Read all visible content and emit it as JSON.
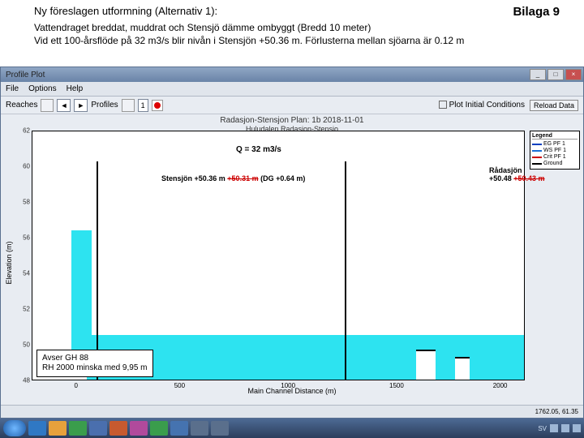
{
  "header": {
    "title_left": "Ny föreslagen utformning (Alternativ 1):",
    "title_right": "Bilaga 9",
    "desc_line1": "Vattendraget breddat, muddrat och Stensjö dämme ombyggt (Bredd 10 meter)",
    "desc_line2": "Vid ett 100-årsflöde på 32 m3/s blir nivån i Stensjön +50.36 m. Förlusterna mellan sjöarna är 0.12 m"
  },
  "window": {
    "title": "Profile Plot"
  },
  "menubar": {
    "file": "File",
    "options": "Options",
    "help": "Help"
  },
  "toolbar": {
    "reaches_label": "Reaches",
    "profiles_label": "Profiles",
    "profiles_value": "1",
    "plot_cond_label": "Plot Initial Conditions",
    "reload_label": "Reload Data"
  },
  "plot": {
    "title": "Radasjon-Stensjon    Plan: 1b  2018-11-01",
    "subtitle": "Huludalen Radasjon-Stensjo",
    "ylabel": "Elevation (m)",
    "xlabel": "Main Channel Distance (m)",
    "yticks": [
      "48",
      "50",
      "52",
      "54",
      "56",
      "58",
      "60",
      "62"
    ],
    "xticks": [
      "0",
      "500",
      "1000",
      "1500",
      "2000"
    ]
  },
  "legend": {
    "title": "Legend",
    "items": [
      "EG PF 1",
      "WS PF 1",
      "Crit PF 1",
      "Ground"
    ]
  },
  "annotations": {
    "q": "Q = 32 m3/s",
    "stensjon": "Stensjön +50.36 m ",
    "stensjon_strike": "+50.31 m",
    "stensjon_tail": " (DG +0.64 m)",
    "radasjon_name": "Rådasjön",
    "radasjon_val": "+50.48 ",
    "radasjon_strike": "+50.43 m",
    "note_line1": "Avser GH 88",
    "note_line2": "RH 2000 minska med 9,95 m"
  },
  "status": {
    "coords": "1762.05, 61.35"
  },
  "taskbar": {
    "colors": [
      "#2f78c4",
      "#e7a13c",
      "#3a9d4c",
      "#4a6fae",
      "#c75a2f",
      "#b04a9c",
      "#3a9d4c",
      "#4573b0",
      "#5a6f8c",
      "#5a6f8c"
    ],
    "tray_text": "SV"
  },
  "chart_data": {
    "type": "area",
    "title": "Radasjon-Stensjon Plan: 1b 2018-11-01",
    "xlabel": "Main Channel Distance (m)",
    "ylabel": "Elevation (m)",
    "xlim": [
      -200,
      2100
    ],
    "ylim": [
      48,
      62
    ],
    "series": [
      {
        "name": "WS PF 1",
        "x": [
          0,
          200,
          400,
          600,
          800,
          1000,
          1200,
          1400,
          1600,
          1800,
          2000
        ],
        "values": [
          50.3,
          50.3,
          50.3,
          50.3,
          50.35,
          50.4,
          50.4,
          50.45,
          50.45,
          50.48,
          50.48
        ]
      },
      {
        "name": "Ground",
        "x": [
          0,
          100,
          150,
          160,
          180,
          300,
          500,
          700,
          900,
          1000,
          1050,
          1100,
          1200,
          1280,
          1300,
          1400,
          1600,
          1700,
          1800,
          1900,
          2000
        ],
        "values": [
          56,
          53,
          60,
          49,
          49.5,
          49.2,
          49,
          49,
          49,
          49,
          49,
          49,
          49.2,
          60,
          49.2,
          49,
          49,
          48.2,
          49.5,
          48.5,
          49.8
        ]
      }
    ]
  }
}
